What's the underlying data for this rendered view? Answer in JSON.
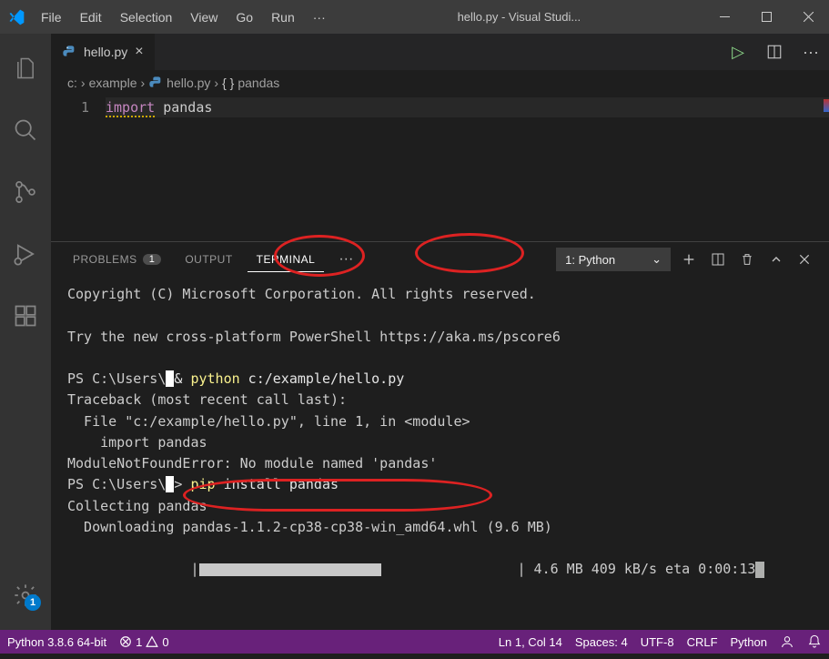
{
  "titlebar": {
    "menus": [
      "File",
      "Edit",
      "Selection",
      "View",
      "Go",
      "Run"
    ],
    "more": "···",
    "title": "hello.py - Visual Studi..."
  },
  "activitybar": {
    "badge": "1"
  },
  "tab": {
    "filename": "hello.py"
  },
  "tabactions": {
    "play": "▷"
  },
  "breadcrumb": {
    "parts": [
      "c:",
      "example",
      "hello.py",
      "pandas"
    ]
  },
  "editor": {
    "lineno": "1",
    "kw": "import",
    "rest": " pandas"
  },
  "panel": {
    "tabs": {
      "problems": "PROBLEMS",
      "problems_count": "1",
      "output": "OUTPUT",
      "terminal": "TERMINAL"
    },
    "selector": "1: Python"
  },
  "terminal": {
    "l1": "Copyright (C) Microsoft Corporation. All rights reserved.",
    "l3": "Try the new cross-platform PowerShell https://aka.ms/pscore6",
    "ps1a": "PS C:\\Users\\",
    "ps1redact": "        ",
    "ps1amp": " & ",
    "ps1py": "python",
    "ps1rest": " c:/example/hello.py",
    "tb1": "Traceback (most recent call last):",
    "tb2": "  File \"c:/example/hello.py\", line 1, in <module>",
    "tb3": "    import pandas",
    "err": "ModuleNotFoundError: No module named 'pandas'",
    "ps2a": "PS C:\\Users\\",
    "ps2redact": "       ",
    "ps2prompt": "> ",
    "ps2pip": "pip",
    "ps2rest": " install pandas",
    "coll": "Collecting pandas",
    "dl": "  Downloading pandas-1.1.2-cp38-cp38-win_amd64.whl (9.6 MB)",
    "prog_pre": "     |",
    "prog_post": "| 4.6 MB 409 kB/s eta 0:00:13"
  },
  "statusbar": {
    "python": "Python 3.8.6 64-bit",
    "errs": "1",
    "warns": "0",
    "lncol": "Ln 1, Col 14",
    "spaces": "Spaces: 4",
    "enc": "UTF-8",
    "eol": "CRLF",
    "lang": "Python"
  }
}
